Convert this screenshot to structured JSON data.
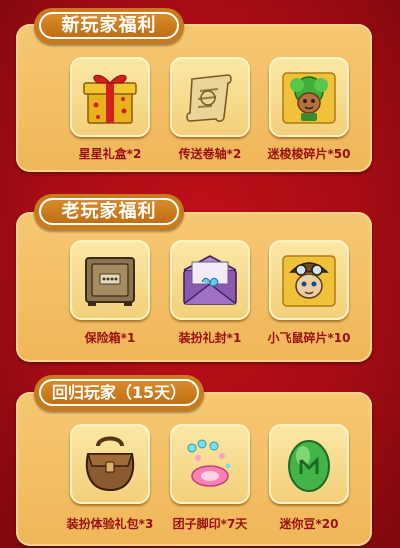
{
  "sections": [
    {
      "title": "新玩家福利",
      "items": [
        {
          "name": "星星礼盒*2",
          "icon": "gift-box-icon"
        },
        {
          "name": "传送卷轴*2",
          "icon": "scroll-icon"
        },
        {
          "name": "迷梭梭碎片*50",
          "icon": "character-fragment-icon"
        }
      ]
    },
    {
      "title": "老玩家福利",
      "items": [
        {
          "name": "保险箱*1",
          "icon": "safe-box-icon"
        },
        {
          "name": "装扮礼封*1",
          "icon": "gift-envelope-icon"
        },
        {
          "name": "小飞鼠碎片*10",
          "icon": "pilot-character-fragment-icon"
        }
      ]
    },
    {
      "title": "回归玩家（15天）",
      "items": [
        {
          "name": "装扮体验礼包*3",
          "icon": "costume-bag-icon"
        },
        {
          "name": "团子脚印*7天",
          "icon": "footprint-icon"
        },
        {
          "name": "迷你豆*20",
          "icon": "mini-bean-icon"
        }
      ]
    }
  ]
}
